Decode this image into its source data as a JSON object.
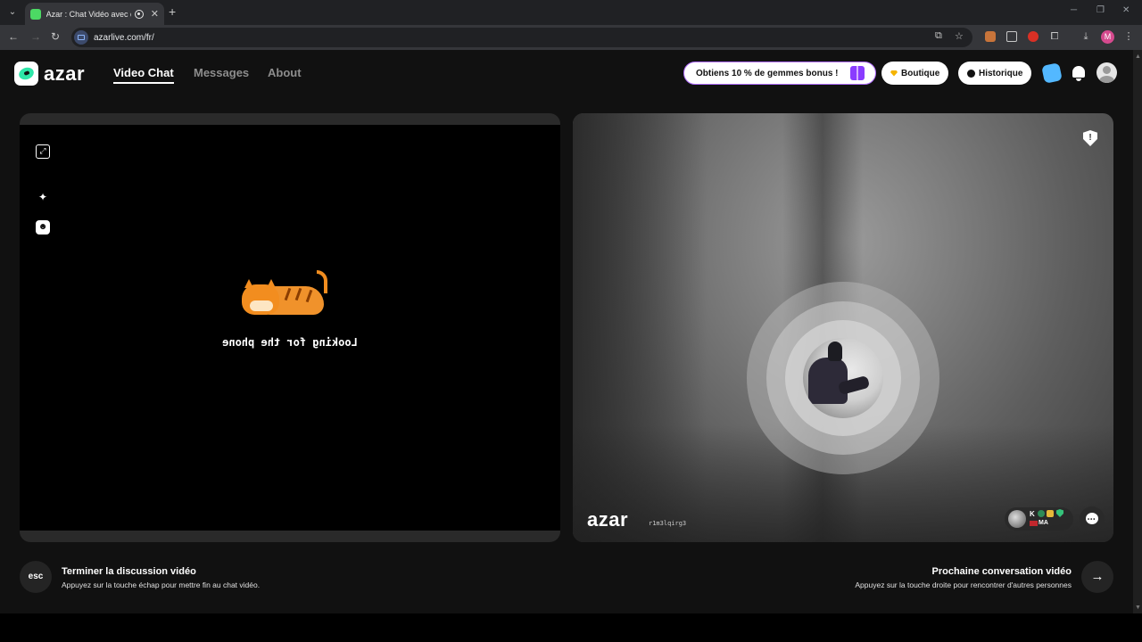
{
  "browser": {
    "tab_title": "Azar : Chat Vidéo avec de n",
    "url": "azarlive.com/fr/",
    "profile_initial": "M"
  },
  "header": {
    "logo_text": "azar",
    "nav": [
      "Video Chat",
      "Messages",
      "About"
    ],
    "active_nav": "Video Chat",
    "promo_label": "Obtiens 10 % de gemmes bonus !",
    "shop_label": "Boutique",
    "history_label": "Historique"
  },
  "left_video": {
    "status_text": "Looking for the phone",
    "icons": [
      "expand-icon",
      "magic-wand-icon",
      "face-filter-icon"
    ]
  },
  "right_video": {
    "watermark": "azar",
    "watermark_id": "r1m3lqirg3",
    "user_name_initial": "K",
    "user_country": "MA",
    "icons": [
      "report-shield-icon",
      "chat-bubble-icon"
    ]
  },
  "footer": {
    "esc_key": "esc",
    "end_title": "Terminer la discussion vidéo",
    "end_sub": "Appuyez sur la touche échap pour mettre fin au chat vidéo.",
    "next_title": "Prochaine conversation vidéo",
    "next_sub": "Appuyez sur la touche droite pour rencontrer d'autres personnes"
  },
  "colors": {
    "accent_green": "#2ee6a8",
    "promo_border": "#b06cff",
    "background": "#111111"
  }
}
